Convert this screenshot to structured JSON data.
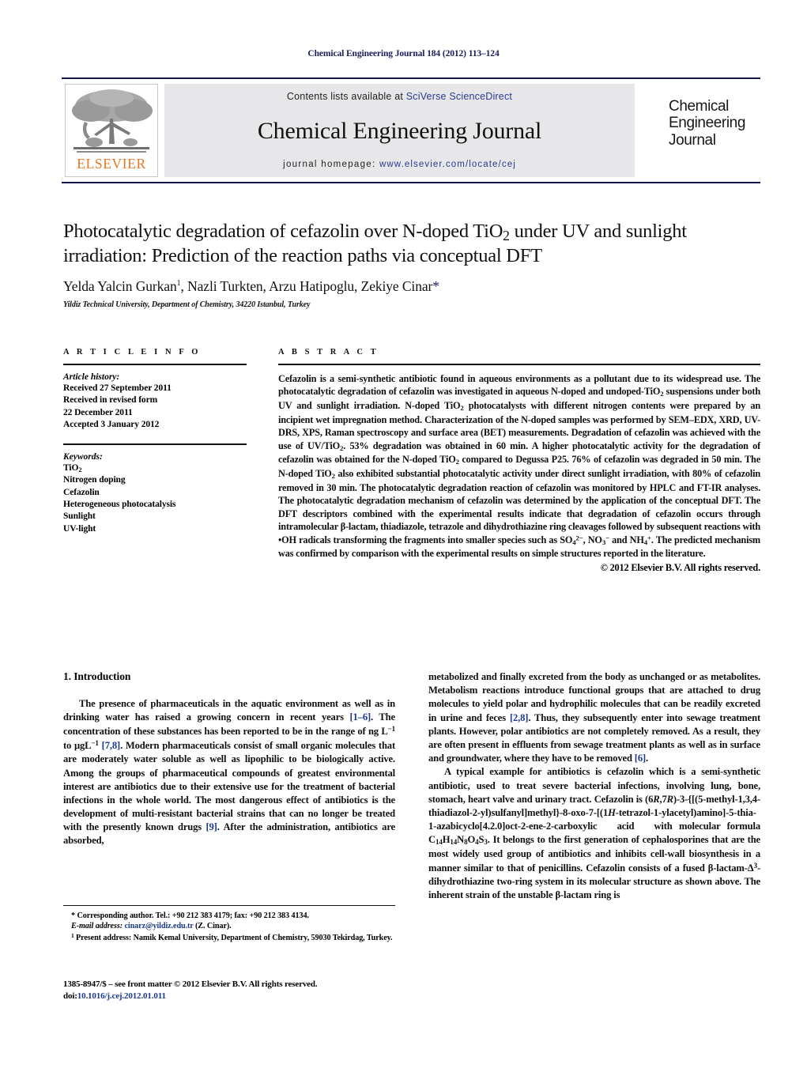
{
  "running_head": "Chemical Engineering Journal 184 (2012) 113–124",
  "masthead": {
    "contents_prefix": "Contents lists available at ",
    "sciencedirect": "SciVerse ScienceDirect",
    "journal_title": "Chemical Engineering Journal",
    "homepage_prefix": "journal homepage: ",
    "homepage_url": "www.elsevier.com/locate/cej",
    "publisher": "ELSEVIER",
    "cover_line1": "Chemical",
    "cover_line2": "Engineering",
    "cover_line3": "Journal",
    "accent_orange": "#e87722",
    "link_blue": "#2b3a8f",
    "banner_bg": "#e7e7e9"
  },
  "title_block": {
    "title": "Photocatalytic degradation of cefazolin over N-doped TiO2 under UV and sunlight irradiation: Prediction of the reaction paths via conceptual DFT",
    "authors": "Yelda Yalcin Gurkan 1, Nazli Turkten, Arzu Hatipoglu, Zekiye Cinar*",
    "affiliation": "Yildiz Technical University, Department of Chemistry, 34220 Istanbul, Turkey"
  },
  "article_info": {
    "heading": "A R T I C L E    I N F O",
    "history_label": "Article history:",
    "history": [
      "Received 27 September 2011",
      "Received in revised form",
      "22 December 2011",
      "Accepted 3 January 2012"
    ],
    "keywords_label": "Keywords:",
    "keywords": [
      "TiO2",
      "Nitrogen doping",
      "Cefazolin",
      "Heterogeneous photocatalysis",
      "Sunlight",
      "UV-light"
    ]
  },
  "abstract": {
    "heading": "A B S T R A C T",
    "text": "Cefazolin is a semi-synthetic antibiotic found in aqueous environments as a pollutant due to its widespread use. The photocatalytic degradation of cefazolin was investigated in aqueous N-doped and undoped-TiO2 suspensions under both UV and sunlight irradiation. N-doped TiO2 photocatalysts with different nitrogen contents were prepared by an incipient wet impregnation method. Characterization of the N-doped samples was performed by SEM–EDX, XRD, UV-DRS, XPS, Raman spectroscopy and surface area (BET) measurements. Degradation of cefazolin was achieved with the use of UV/TiO2. 53% degradation was obtained in 60 min. A higher photocatalytic activity for the degradation of cefazolin was obtained for the N-doped TiO2 compared to Degussa P25. 76% of cefazolin was degraded in 50 min. The N-doped TiO2 also exhibited substantial photocatalytic activity under direct sunlight irradiation, with 80% of cefazolin removed in 30 min. The photocatalytic degradation reaction of cefazolin was monitored by HPLC and FT-IR analyses. The photocatalytic degradation mechanism of cefazolin was determined by the application of the conceptual DFT. The DFT descriptors combined with the experimental results indicate that degradation of cefazolin occurs through intramolecular β-lactam, thiadiazole, tetrazole and dihydrothiazine ring cleavages followed by subsequent reactions with •OH radicals transforming the fragments into smaller species such as SO42−, NO3− and NH4+. The predicted mechanism was confirmed by comparison with the experimental results on simple structures reported in the literature.",
    "copyright": "© 2012 Elsevier B.V. All rights reserved."
  },
  "body": {
    "section_heading": "1.  Introduction",
    "left_paragraphs": [
      "The presence of pharmaceuticals in the aquatic environment as well as in drinking water has raised a growing concern in recent years [1–6]. The concentration of these substances has been reported to be in the range of ng L−1 to μgL−1 [7,8]. Modern pharmaceuticals consist of small organic molecules that are moderately water soluble as well as lipophilic to be biologically active. Among the groups of pharmaceutical compounds of greatest environmental interest are antibiotics due to their extensive use for the treatment of bacterial infections in the whole world. The most dangerous effect of antibiotics is the development of multi-resistant bacterial strains that can no longer be treated with the presently known drugs [9]. After the administration, antibiotics are absorbed,"
    ],
    "right_paragraphs": [
      "metabolized and finally excreted from the body as unchanged or as metabolites. Metabolism reactions introduce functional groups that are attached to drug molecules to yield polar and hydrophilic molecules that can be readily excreted in urine and feces [2,8]. Thus, they subsequently enter into sewage treatment plants. However, polar antibiotics are not completely removed. As a result, they are often present in effluents from sewage treatment plants as well as in surface and groundwater, where they have to be removed [6].",
      "A typical example for antibiotics is cefazolin which is a semi-synthetic antibiotic, used to treat severe bacterial infections, involving lung, bone, stomach, heart valve and urinary tract. Cefazolin is (6R,7R)-3-{[(5-methyl-1,3,4-thiadiazol-2-yl)sulfanyl]methyl}-8-oxo-7-[(1H-tetrazol-1-ylacetyl)amino]-5-thia-1-azabicyclo[4.2.0]oct-2-ene-2-carboxylic acid with molecular formula C14H14N8O4S3. It belongs to the first generation of cephalosporines that are the most widely used group of antibiotics and inhibits cell-wall biosynthesis in a manner similar to that of penicillins. Cefazolin consists of a fused β-lactam-Δ3-dihydrothiazine two-ring system in its molecular structure as shown above. The inherent strain of the unstable β-lactam ring is"
    ]
  },
  "footnotes": {
    "corresponding": "* Corresponding author. Tel.: +90 212 383 4179; fax: +90 212 383 4134.",
    "email_label": "E-mail address:",
    "email": "cinarz@yildiz.edu.tr",
    "email_suffix": "(Z. Cinar).",
    "present_address": "1 Present address: Namik Kemal University, Department of Chemistry, 59030 Tekirdag, Turkey.",
    "imprint": "1385-8947/$ – see front matter © 2012 Elsevier B.V. All rights reserved.",
    "doi_label": "doi:",
    "doi": "10.1016/j.cej.2012.01.011"
  }
}
